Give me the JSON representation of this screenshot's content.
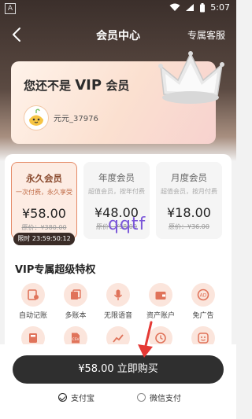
{
  "status": {
    "badge": "A",
    "time": "5:07"
  },
  "nav": {
    "title": "会员中心",
    "service": "专属客服"
  },
  "vip_card": {
    "prefix": "您还不是",
    "vip": "VIP",
    "suffix": "会员",
    "username": "元元_37976"
  },
  "plans": [
    {
      "name": "永久会员",
      "desc": "一次付费，永久享受",
      "price": "¥58.00",
      "orig": "原价：¥380.00",
      "selected": true
    },
    {
      "name": "年度会员",
      "desc": "超值会员，按年付费",
      "price": "¥48.00",
      "orig": "原价：¥98.00",
      "selected": false
    },
    {
      "name": "月度会员",
      "desc": "超值会员，按月付费",
      "price": "¥18.00",
      "orig": "原价：¥36.00",
      "selected": false
    }
  ],
  "timer": "限时 23:59:50:12",
  "watermark": "qqtf",
  "privileges": {
    "title": "VIP专属超级特权",
    "items": [
      {
        "label": "自动记账",
        "icon": "auto-bookkeeping-icon"
      },
      {
        "label": "多账本",
        "icon": "multi-ledger-icon"
      },
      {
        "label": "无限语音",
        "icon": "microphone-icon"
      },
      {
        "label": "资产账户",
        "icon": "wallet-icon"
      },
      {
        "label": "免广告",
        "icon": "no-ad-icon"
      }
    ],
    "row2_icons": [
      "calculator-icon",
      "csv-export-icon",
      "chart-icon",
      "clock-icon",
      "face-icon"
    ]
  },
  "purchase": {
    "button": "¥58.00 立即购买"
  },
  "payment": {
    "alipay": "支付宝",
    "wechat": "微信支付",
    "selected": "alipay"
  },
  "colors": {
    "accent": "#e58a67",
    "dark": "#2f2f2f",
    "icon_bg": "#fbe5dc"
  }
}
